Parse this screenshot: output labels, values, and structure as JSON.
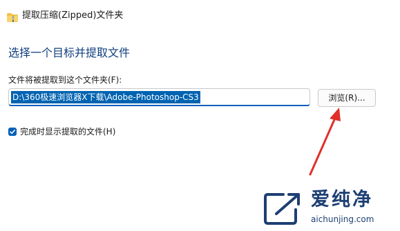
{
  "window": {
    "title": "提取压缩(Zipped)文件夹",
    "icon": "folder-zip-icon"
  },
  "main": {
    "heading": "选择一个目标并提取文件",
    "destination_label": "文件将被提取到这个文件夹(F):",
    "destination_value": "D:\\360极速浏览器X下载\\Adobe-Photoshop-CS3",
    "browse_label": "浏览(R)...",
    "show_files_label": "完成时显示提取的文件(H)",
    "show_files_checked": true
  },
  "annotation": {
    "arrow_color": "#e0302a",
    "arrow_target": "browse-button"
  },
  "watermark": {
    "title": "爱纯净",
    "url": "aichunjing.com"
  },
  "colors": {
    "accent": "#005fb8",
    "heading": "#0f3e7e",
    "selection": "#0063b1",
    "watermark": "#1d3f73"
  }
}
